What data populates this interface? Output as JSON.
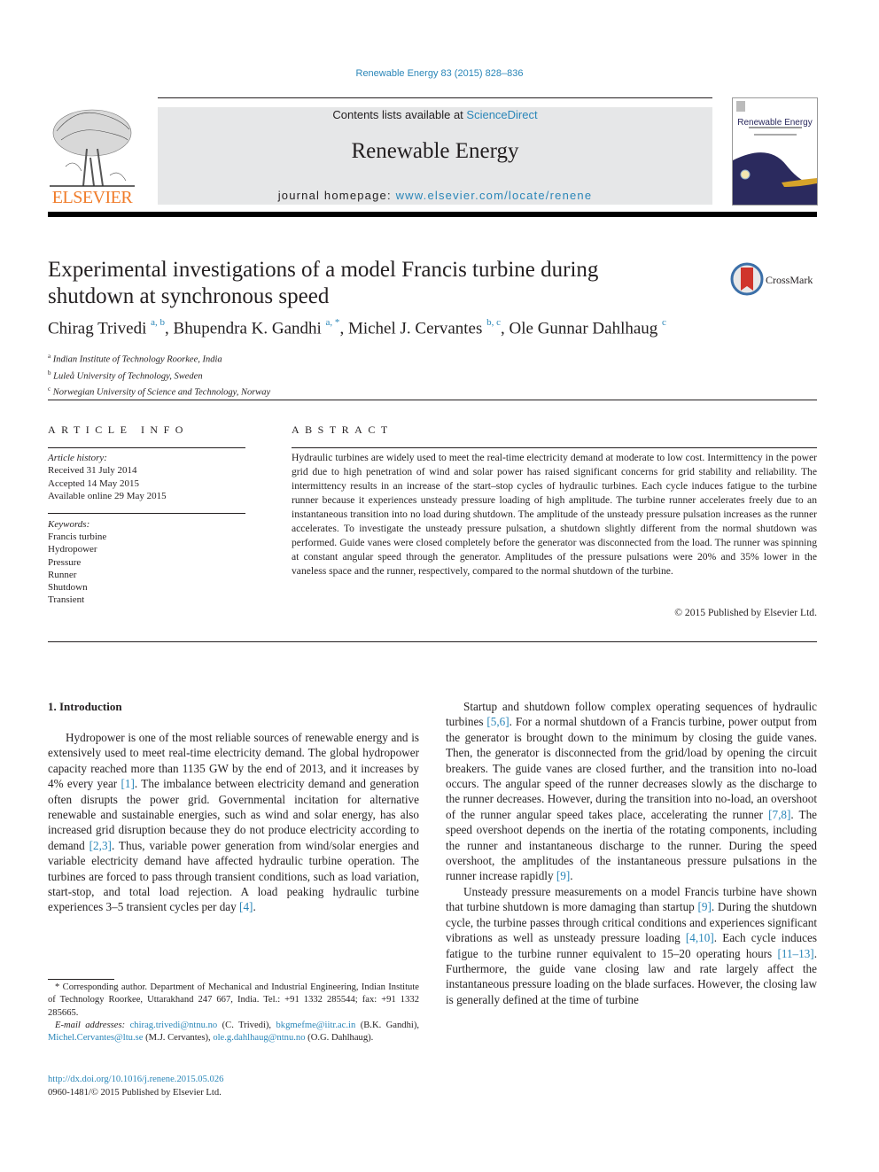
{
  "header": {
    "citation": "Renewable Energy 83 (2015) 828–836",
    "contents_prefix": "Contents lists available at ",
    "contents_link": "ScienceDirect",
    "journal_name": "Renewable Energy",
    "homepage_prefix": "journal homepage: ",
    "homepage_link": "www.elsevier.com/locate/renene",
    "publisher_logo_text": "ELSEVIER",
    "cover_title": "Renewable Energy",
    "colors": {
      "link": "#2a86b8",
      "elsevier_orange": "#f07c2a",
      "banner_bg": "#e6e7e8",
      "cover_navy": "#2b2a5e",
      "cover_gold": "#d6a32a"
    }
  },
  "article": {
    "title_line1": "Experimental investigations of a model Francis turbine during",
    "title_line2": "shutdown at synchronous speed",
    "crossmark_label": "CrossMark",
    "authors": [
      {
        "name": "Chirag Trivedi",
        "marks": "a, b"
      },
      {
        "name": "Bhupendra K. Gandhi",
        "marks": "a, *"
      },
      {
        "name": "Michel J. Cervantes",
        "marks": "b, c"
      },
      {
        "name": "Ole Gunnar Dahlhaug",
        "marks": "c"
      }
    ],
    "affiliations": [
      {
        "mark": "a",
        "text": "Indian Institute of Technology Roorkee, India"
      },
      {
        "mark": "b",
        "text": "Luleå University of Technology, Sweden"
      },
      {
        "mark": "c",
        "text": "Norwegian University of Science and Technology, Norway"
      }
    ]
  },
  "article_info": {
    "heading": "ARTICLE INFO",
    "history_label": "Article history:",
    "history": [
      "Received 31 July 2014",
      "Accepted 14 May 2015",
      "Available online 29 May 2015"
    ],
    "keywords_label": "Keywords:",
    "keywords": [
      "Francis turbine",
      "Hydropower",
      "Pressure",
      "Runner",
      "Shutdown",
      "Transient"
    ]
  },
  "abstract": {
    "heading": "ABSTRACT",
    "text": "Hydraulic turbines are widely used to meet the real-time electricity demand at moderate to low cost. Intermittency in the power grid due to high penetration of wind and solar power has raised significant concerns for grid stability and reliability. The intermittency results in an increase of the start–stop cycles of hydraulic turbines. Each cycle induces fatigue to the turbine runner because it experiences unsteady pressure loading of high amplitude. The turbine runner accelerates freely due to an instantaneous transition into no load during shutdown. The amplitude of the unsteady pressure pulsation increases as the runner accelerates. To investigate the unsteady pressure pulsation, a shutdown slightly different from the normal shutdown was performed. Guide vanes were closed completely before the generator was disconnected from the load. The runner was spinning at constant angular speed through the generator. Amplitudes of the pressure pulsations were 20% and 35% lower in the vaneless space and the runner, respectively, compared to the normal shutdown of the turbine.",
    "copyright": "© 2015 Published by Elsevier Ltd."
  },
  "body": {
    "section_heading": "1.  Introduction",
    "left_para": [
      {
        "t": "Hydropower is one of the most reliable sources of renewable energy and is extensively used to meet real-time electricity demand. The global hydropower capacity reached more than 1135 GW by the end of 2013, and it increases by 4% every year "
      },
      {
        "c": "[1]"
      },
      {
        "t": ". The imbalance between electricity demand and generation often disrupts the power grid. Governmental incitation for alternative renewable and sustainable energies, such as wind and solar energy, has also increased grid disruption because they do not produce electricity according to demand "
      },
      {
        "c": "[2,3]"
      },
      {
        "t": ". Thus, variable power generation from wind/solar energies and variable electricity demand have affected hydraulic turbine operation. The turbines are forced to pass through transient conditions, such as load variation, start-stop, and total load rejection. A load peaking hydraulic turbine experiences 3–5 transient cycles per day "
      },
      {
        "c": "[4]"
      },
      {
        "t": "."
      }
    ],
    "right_para_1": [
      {
        "t": "Startup and shutdown follow complex operating sequences of hydraulic turbines "
      },
      {
        "c": "[5,6]"
      },
      {
        "t": ". For a normal shutdown of a Francis turbine, power output from the generator is brought down to the minimum by closing the guide vanes. Then, the generator is disconnected from the grid/load by opening the circuit breakers. The guide vanes are closed further, and the transition into no-load occurs. The angular speed of the runner decreases slowly as the discharge to the runner decreases. However, during the transition into no-load, an overshoot of the runner angular speed takes place, accelerating the runner "
      },
      {
        "c": "[7,8]"
      },
      {
        "t": ". The speed overshoot depends on the inertia of the rotating components, including the runner and instantaneous discharge to the runner. During the speed overshoot, the amplitudes of the instantaneous pressure pulsations in the runner increase rapidly "
      },
      {
        "c": "[9]"
      },
      {
        "t": "."
      }
    ],
    "right_para_2": [
      {
        "t": "Unsteady pressure measurements on a model Francis turbine have shown that turbine shutdown is more damaging than startup "
      },
      {
        "c": "[9]"
      },
      {
        "t": ". During the shutdown cycle, the turbine passes through critical conditions and experiences significant vibrations as well as unsteady pressure loading "
      },
      {
        "c": "[4,10]"
      },
      {
        "t": ". Each cycle induces fatigue to the turbine runner equivalent to 15–20 operating hours "
      },
      {
        "c": "[11–13]"
      },
      {
        "t": ". Furthermore, the guide vane closing law and rate largely affect the instantaneous pressure loading on the blade surfaces. However, the closing law is generally defined at the time of turbine"
      }
    ]
  },
  "footnotes": {
    "corresponding": "* Corresponding author. Department of Mechanical and Industrial Engineering, Indian Institute of Technology Roorkee, Uttarakhand 247 667, India. Tel.: +91 1332 285544; fax: +91 1332 285665.",
    "email_label": "E-mail addresses:",
    "emails": [
      {
        "email": "chirag.trivedi@ntnu.no",
        "who": "(C. Trivedi),"
      },
      {
        "email": "bkgmefme@iitr.ac.in",
        "who": "(B.K. Gandhi),"
      },
      {
        "email": "Michel.Cervantes@ltu.se",
        "who": "(M.J. Cervantes),"
      },
      {
        "email": "ole.g.dahlhaug@ntnu.no",
        "who": "(O.G. Dahlhaug)."
      }
    ],
    "doi": "http://dx.doi.org/10.1016/j.renene.2015.05.026",
    "issn_line": "0960-1481/© 2015 Published by Elsevier Ltd."
  }
}
